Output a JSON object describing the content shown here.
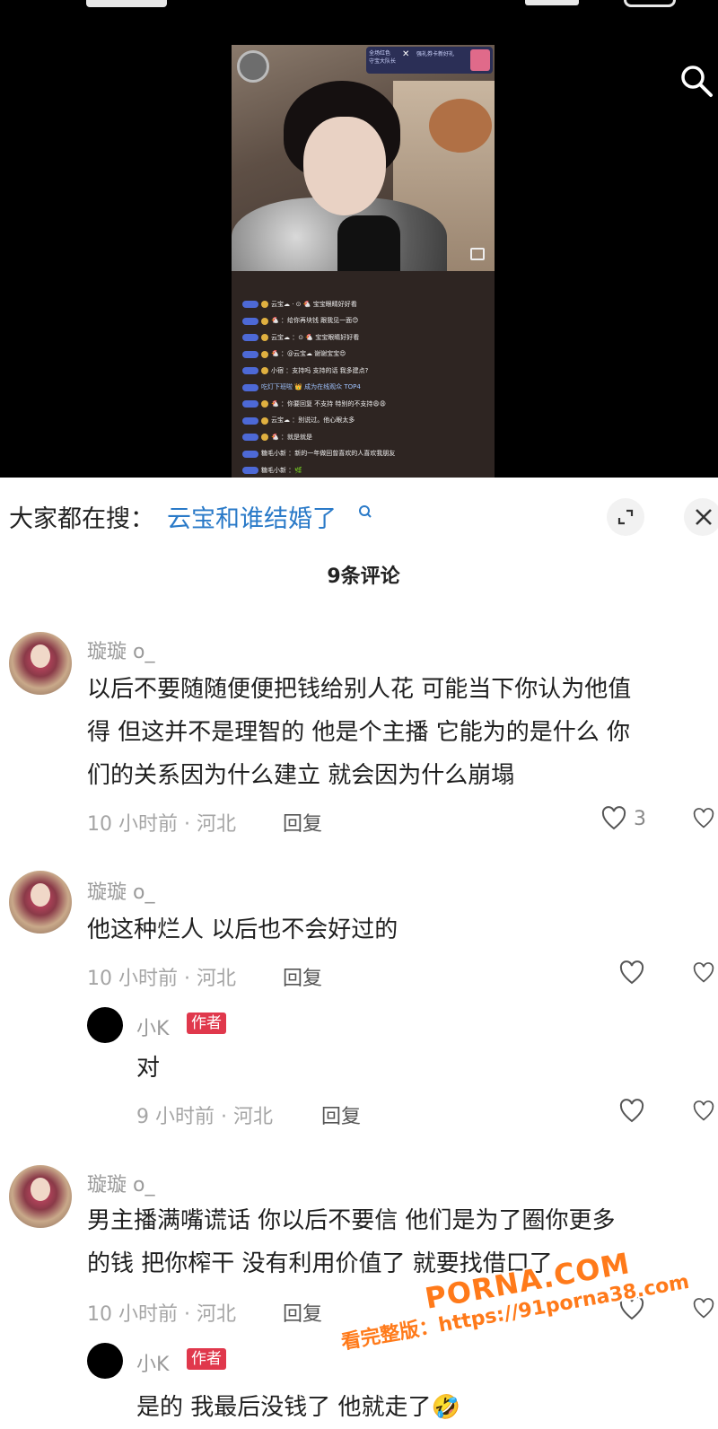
{
  "search_bar": {
    "prefix": "大家都在搜：",
    "query": "云宝和谁结婚了"
  },
  "comments_header": {
    "count_label": "9条评论"
  },
  "stream": {
    "badge_line1": "全场红色",
    "badge_line2": "守宝大队长",
    "badge_x": "✕",
    "badge_promo": "强礼券卡新好礼"
  },
  "danmu": [
    "云宝☁ · ⊙ 🐔 宝宝眼睛好好看",
    "🐔 ：给你再块钱 跟我见一面😊",
    "云宝☁ ：⊙ 🐔 宝宝眼睛好好看",
    "🐔 ：@云宝☁ 谢谢宝宝😍",
    "小宿 ：支持吗 支持的话 我多建点?",
    "吃灯下班啦 👑 成为在线观众 TOP4",
    "🐔 ：你要回复 不支持 特别的不支持😩😩",
    "云宝☁ ：别说过。他心眼太多",
    "🐔 ：就是就是",
    "糖毛小新 ：新的一年做回曾喜欢的人喜欢我朋友",
    "糖毛小新 ：🌿"
  ],
  "comments": [
    {
      "user": "璇璇 o_",
      "lines": [
        "以后不要随随便便把钱给别人花 可能当下你认为他值",
        "得 但这并不是理智的 他是个主播 它能为的是什么 你",
        "们的关系因为什么建立 就会因为什么崩塌"
      ],
      "meta": "10 小时前 · 河北",
      "reply": "回复",
      "likes": "3"
    },
    {
      "user": "璇璇 o_",
      "lines": [
        "他这种烂人 以后也不会好过的"
      ],
      "meta": "10 小时前 · 河北",
      "reply": "回复",
      "likes": ""
    },
    {
      "user": "小K",
      "author_tag": "作者",
      "lines": [
        "对"
      ],
      "meta": "9 小时前 · 河北",
      "reply": "回复",
      "likes": ""
    },
    {
      "user": "璇璇 o_",
      "lines": [
        "男主播满嘴谎话 你以后不要信 他们是为了圈你更多",
        "的钱 把你榨干 没有利用价值了 就要找借口了"
      ],
      "meta": "10 小时前 · 河北",
      "reply": "回复",
      "likes": ""
    },
    {
      "user": "小K",
      "author_tag": "作者",
      "lines": [
        "是的 我最后没钱了 他就走了🤣"
      ],
      "meta": "",
      "reply": "",
      "likes": ""
    }
  ],
  "watermark": {
    "line1": "PORNA.COM",
    "line2": "看完整版：https://91porna38.com"
  },
  "colors": {
    "accent_link": "#2a7ac8",
    "author_tag": "#e0384c",
    "watermark": "#ff7a1a"
  }
}
